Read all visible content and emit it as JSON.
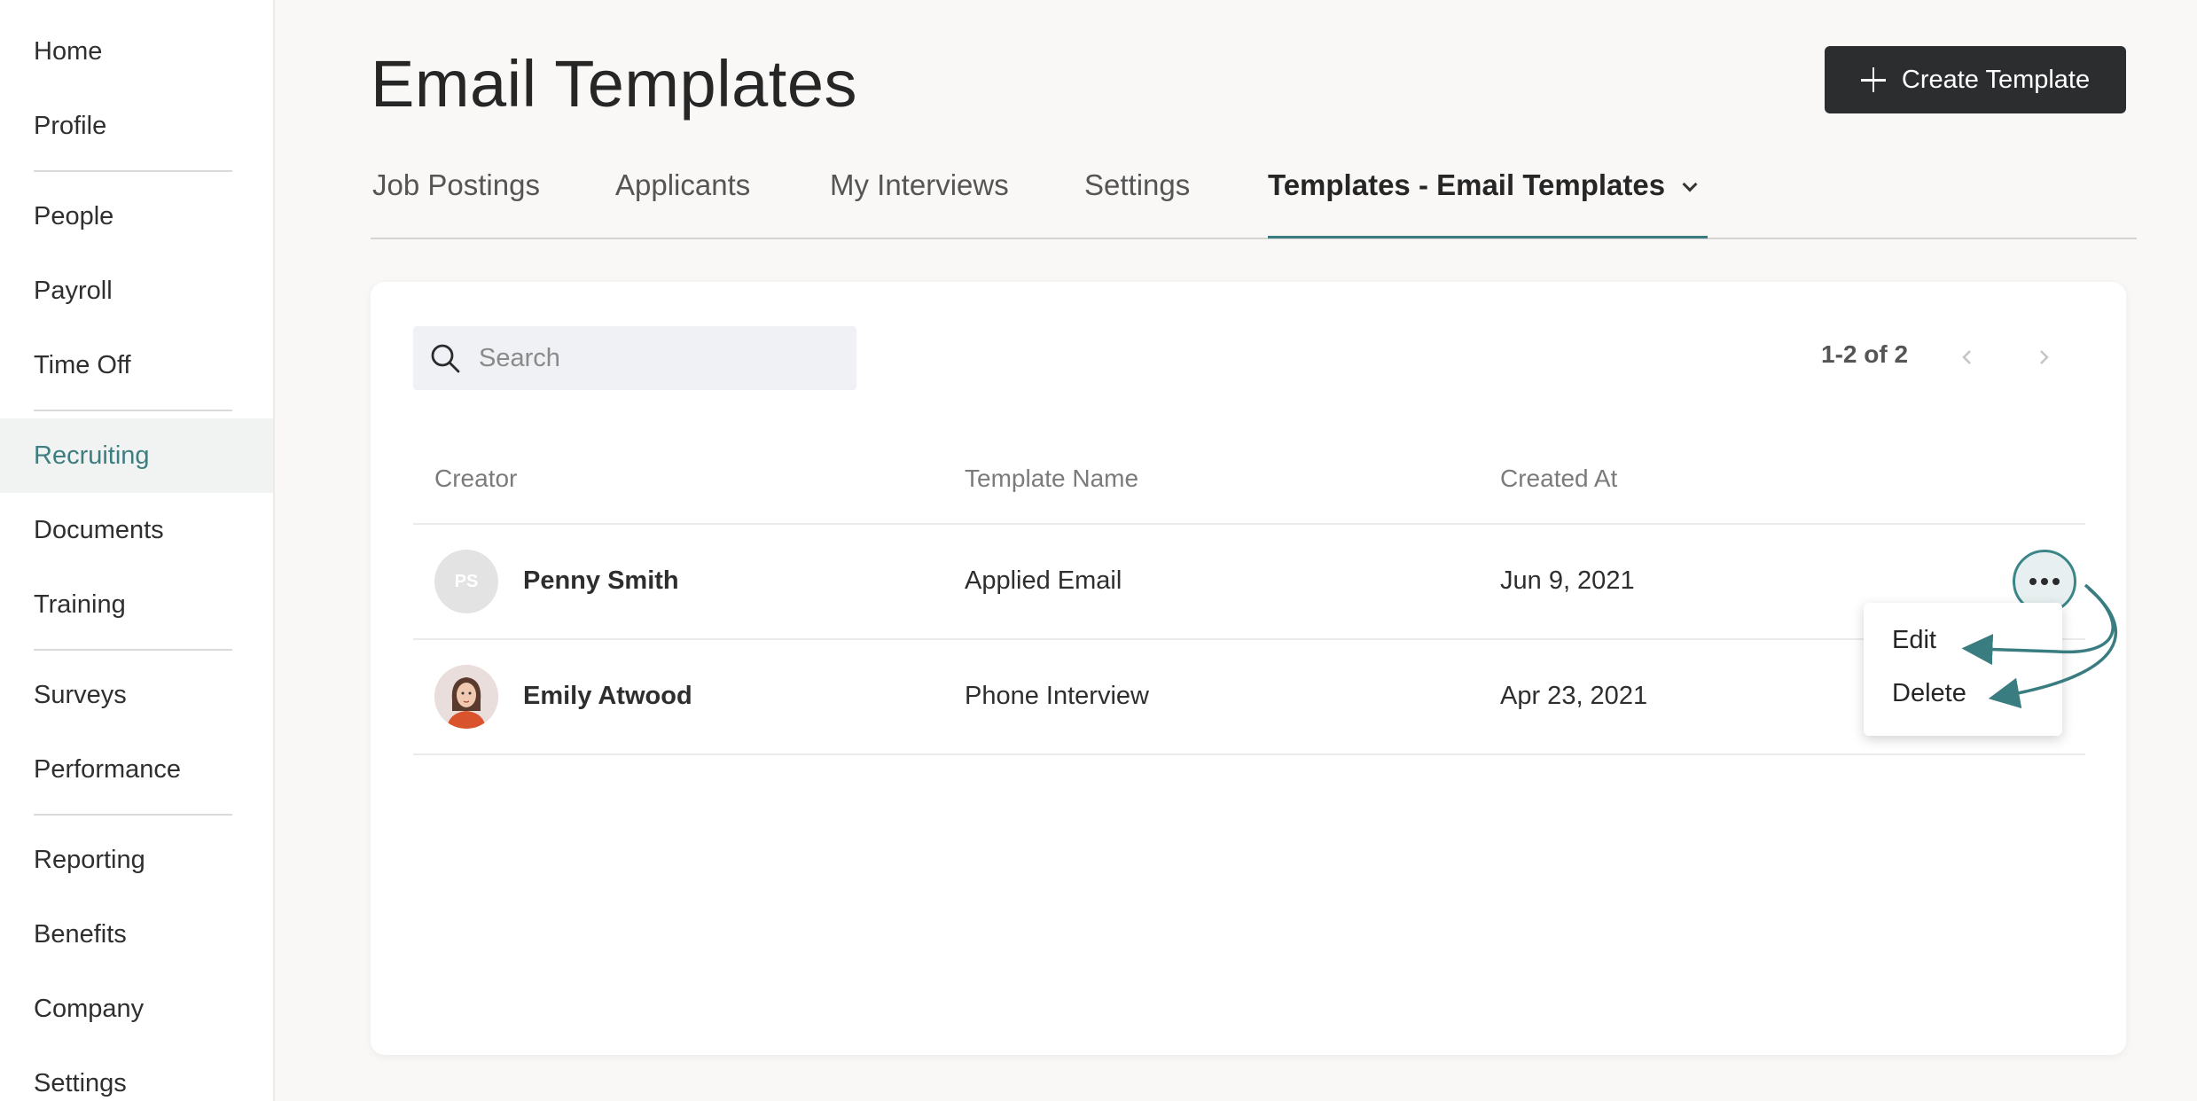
{
  "sidebar": {
    "items": [
      {
        "label": "Home"
      },
      {
        "label": "Profile"
      },
      {
        "label": "People"
      },
      {
        "label": "Payroll"
      },
      {
        "label": "Time Off"
      },
      {
        "label": "Recruiting"
      },
      {
        "label": "Documents"
      },
      {
        "label": "Training"
      },
      {
        "label": "Surveys"
      },
      {
        "label": "Performance"
      },
      {
        "label": "Reporting"
      },
      {
        "label": "Benefits"
      },
      {
        "label": "Company"
      },
      {
        "label": "Settings"
      }
    ],
    "active": "Recruiting"
  },
  "header": {
    "title": "Email Templates",
    "create_button": "Create Template"
  },
  "tabs": [
    {
      "label": "Job Postings"
    },
    {
      "label": "Applicants"
    },
    {
      "label": "My Interviews"
    },
    {
      "label": "Settings"
    },
    {
      "label": "Templates - Email Templates"
    }
  ],
  "search": {
    "placeholder": "Search",
    "value": ""
  },
  "pagination": {
    "text": "1-2 of 2"
  },
  "table": {
    "columns": [
      "Creator",
      "Template Name",
      "Created At"
    ],
    "rows": [
      {
        "avatar_initials": "PS",
        "creator": "Penny Smith",
        "template": "Applied Email",
        "created": "Jun 9, 2021"
      },
      {
        "avatar_initials": "",
        "creator": "Emily Atwood",
        "template": "Phone Interview",
        "created": "Apr 23, 2021"
      }
    ]
  },
  "row_menu": {
    "items": [
      "Edit",
      "Delete"
    ]
  },
  "colors": {
    "accent": "#3a7d80",
    "button_dark": "#2c2d2f",
    "background": "#f9f8f7"
  }
}
